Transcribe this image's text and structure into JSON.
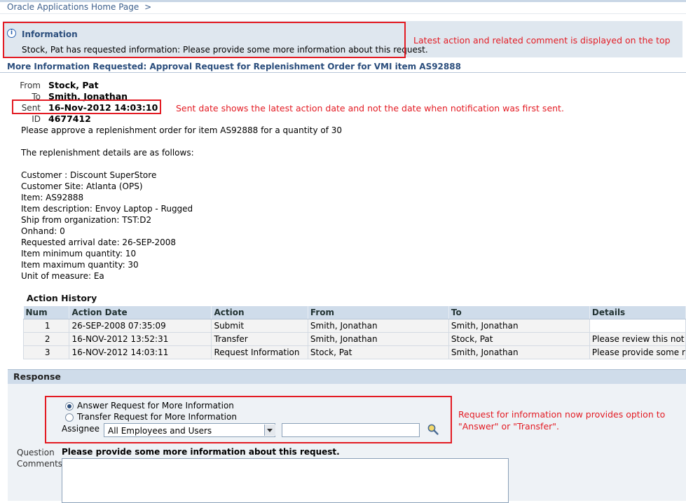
{
  "breadcrumb": {
    "home": "Oracle Applications Home Page",
    "sep": ">"
  },
  "info": {
    "title": "Information",
    "message": "Stock, Pat has requested information: Please provide some more information about this request."
  },
  "notes": {
    "top": "Latest action and related comment is displayed on the top",
    "sent": "Sent date shows the latest action date and not the date when notification was first sent.",
    "response_line1": "Request for information now provides option to",
    "response_line2": "\"Answer\" or \"Transfer\"."
  },
  "notification": {
    "header": "More Information Requested: Approval Request for Replenishment Order for VMI item AS92888",
    "from_label": "From",
    "from": "Stock, Pat",
    "to_label": "To",
    "to": "Smith, Jonathan",
    "sent_label": "Sent",
    "sent": "16-Nov-2012 14:03:10",
    "id_label": "ID",
    "id": "4677412",
    "body": [
      "Please approve a replenishment order for item AS92888 for a quantity of 30",
      "The replenishment details are as follows:",
      "Customer : Discount SuperStore",
      "Customer Site: Atlanta (OPS)",
      "Item: AS92888",
      "Item description: Envoy Laptop - Rugged",
      "Ship from organization: TST:D2",
      "Onhand: 0",
      "Requested arrival date: 26-SEP-2008",
      "Item minimum quantity: 10",
      "Item maximum quantity: 30",
      "Unit of measure: Ea"
    ]
  },
  "action_history": {
    "title": "Action History",
    "columns": [
      "Num",
      "Action Date",
      "Action",
      "From",
      "To",
      "Details"
    ],
    "rows": [
      [
        "1",
        "26-SEP-2008 07:35:09",
        "Submit",
        "Smith, Jonathan",
        "Smith, Jonathan",
        ""
      ],
      [
        "2",
        "16-NOV-2012 13:52:31",
        "Transfer",
        "Smith, Jonathan",
        "Stock, Pat",
        "Please review this not"
      ],
      [
        "3",
        "16-NOV-2012 14:03:11",
        "Request Information",
        "Stock, Pat",
        "Smith, Jonathan",
        "Please provide some r"
      ]
    ]
  },
  "response": {
    "title": "Response",
    "option_answer": "Answer Request for More Information",
    "option_transfer": "Transfer Request for More Information",
    "assignee_label": "Assignee",
    "assignee_select": "All Employees and Users",
    "question_label": "Question",
    "question": "Please provide some more information about this request.",
    "comments_label": "Comments"
  },
  "colors": {
    "annotation": "#e31b23",
    "header_blue": "#2a4d7c",
    "table_header": "#cfdcea"
  }
}
